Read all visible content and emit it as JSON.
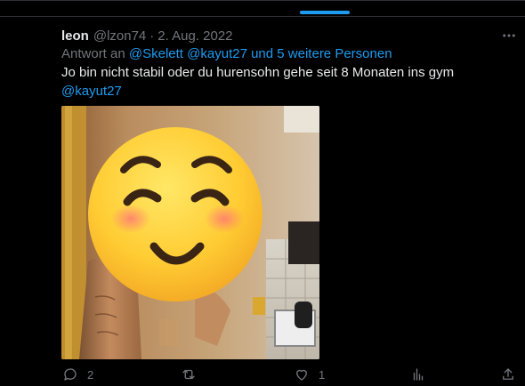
{
  "tweet": {
    "author_name": "leon",
    "author_handle": "@lzon74",
    "separator": "·",
    "date": "2. Aug. 2022",
    "reply_prefix": "Antwort an",
    "reply_mention_1": "@Skelett",
    "reply_mention_2": "@kayut27",
    "reply_suffix": "und 5 weitere Personen",
    "text": "Jo bin nicht stabil oder du hurensohn gehe seit 8 Monaten ins gym",
    "text_mention": "@kayut27",
    "media": {
      "description_icon": "smiling-face-emoji-icon"
    }
  },
  "actions": {
    "reply_count": "2",
    "retweet_count": "",
    "like_count": "1",
    "views_count": ""
  },
  "icons": {
    "more": "more-options-icon",
    "reply": "reply-icon",
    "retweet": "retweet-icon",
    "like": "heart-icon",
    "views": "analytics-icon",
    "share": "share-icon"
  },
  "colors": {
    "background": "#000000",
    "text": "#e7e9ea",
    "secondary": "#71767b",
    "accent": "#1d9bf0",
    "separator": "#2f3336"
  }
}
